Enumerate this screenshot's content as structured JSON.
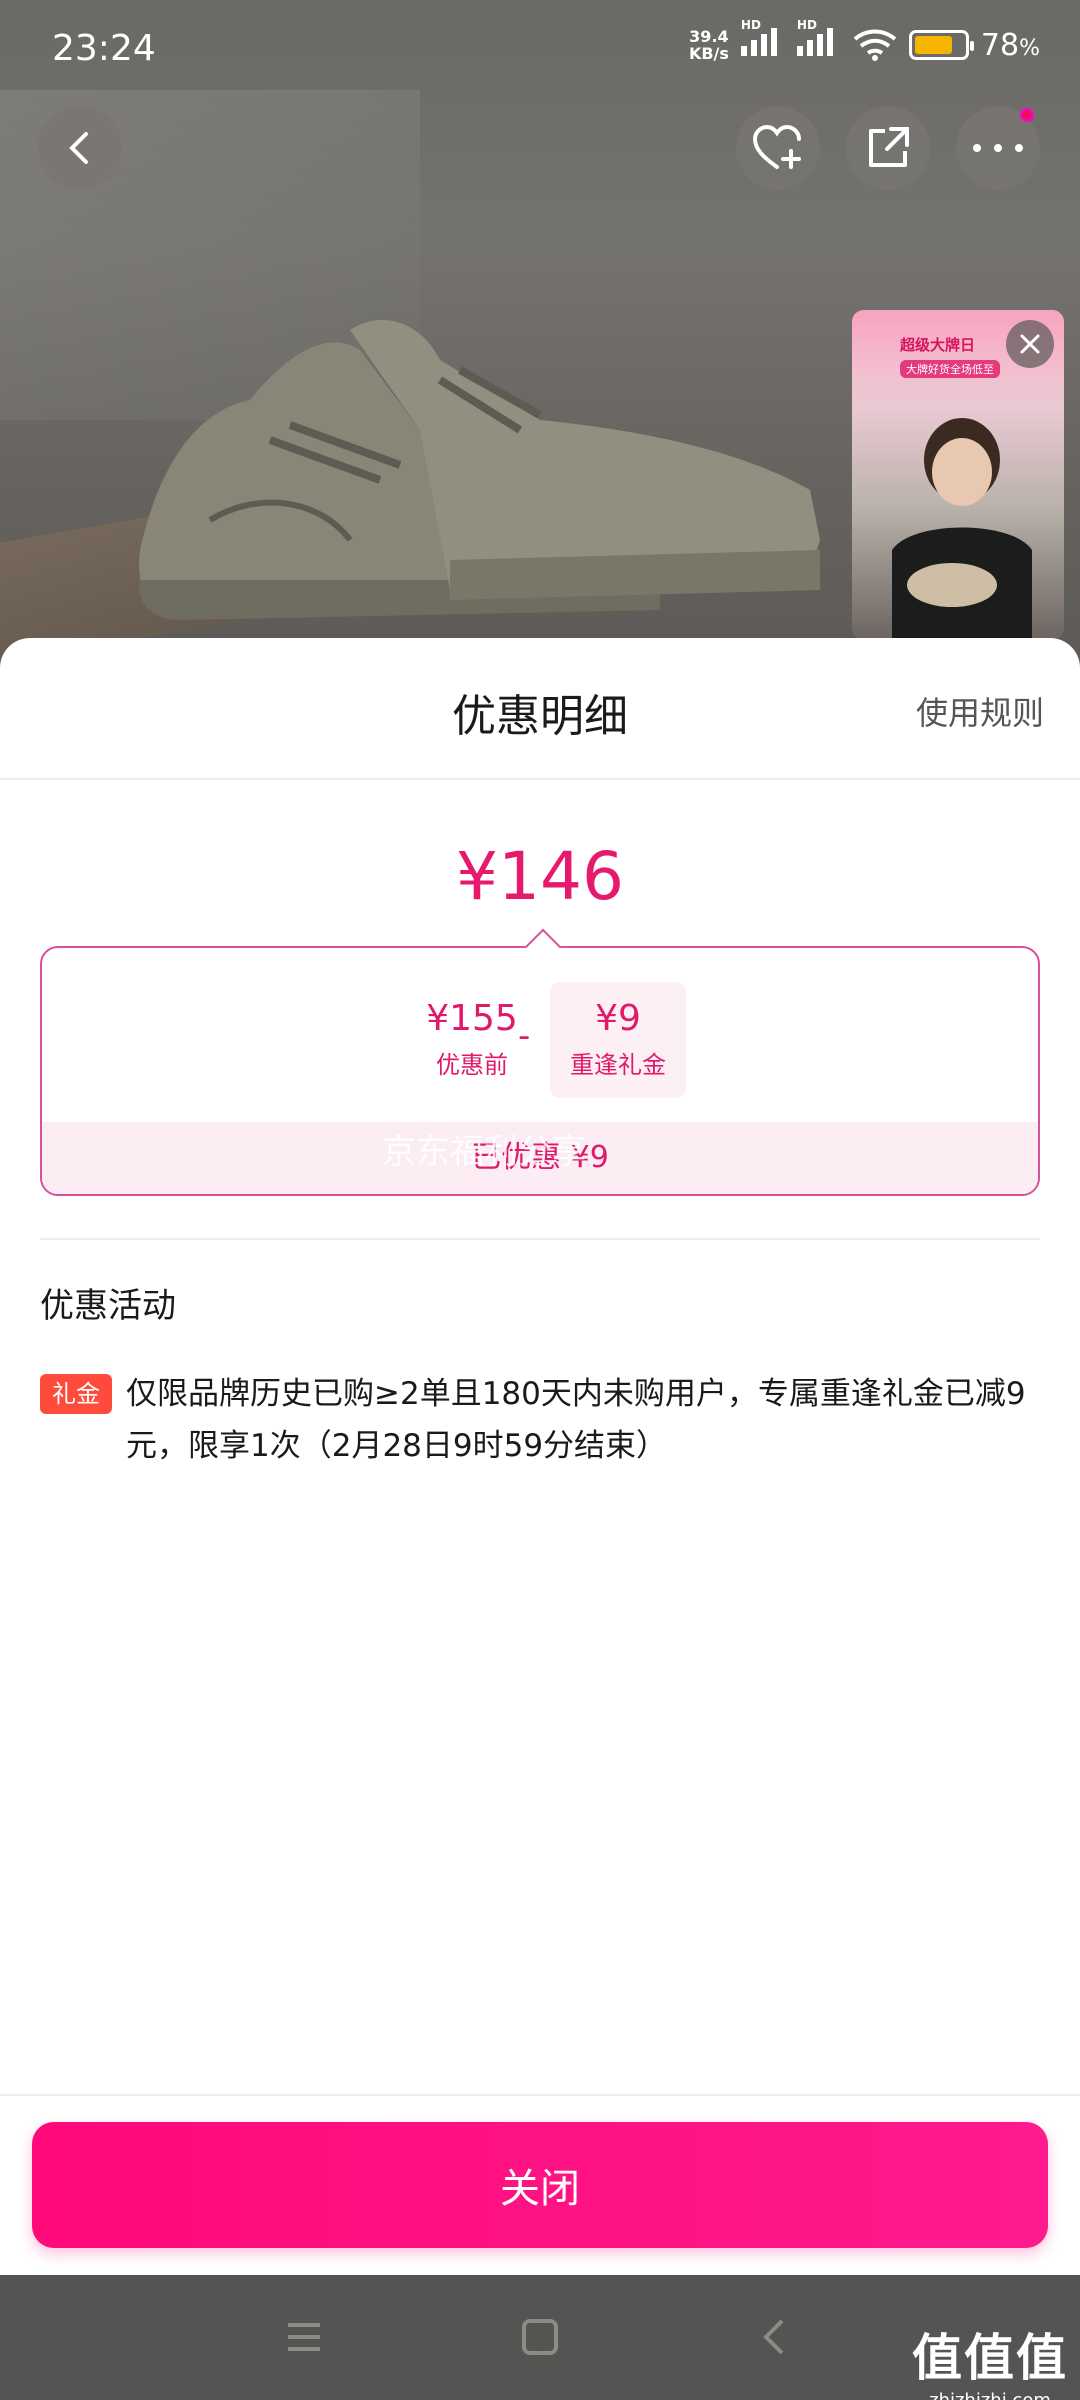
{
  "status_bar": {
    "time": "23:24",
    "net_speed_value": "39.4",
    "net_speed_unit": "KB/s",
    "signal_1": "HD",
    "signal_2": "HD",
    "battery_percent": "78",
    "battery_unit": "%",
    "battery_level": 0.78
  },
  "live_card": {
    "banner_title": "超级大牌日",
    "banner_sub": "大牌好货全场低至"
  },
  "sheet": {
    "title": "优惠明细",
    "rules_link": "使用规则",
    "final_price": "¥146",
    "original_price": "¥155",
    "original_label": "优惠前",
    "minus": "-",
    "discount_value": "¥9",
    "discount_label": "重逢礼金",
    "saved_text": "已优惠 ¥9",
    "watermark": "京东福利分享",
    "section_title": "优惠活动",
    "promo_tag": "礼金",
    "promo_desc": "仅限品牌历史已购≥2单且180天内未购用户，专属重逢礼金已减9元，限享1次（2月28日9时59分结束）",
    "close_label": "关闭"
  },
  "watermark": {
    "logo": "值值值",
    "site": "zhizhizhi.com"
  },
  "colors": {
    "accent": "#e6196d",
    "close_button": "#ff0a78",
    "tag": "#ff4b3c"
  }
}
